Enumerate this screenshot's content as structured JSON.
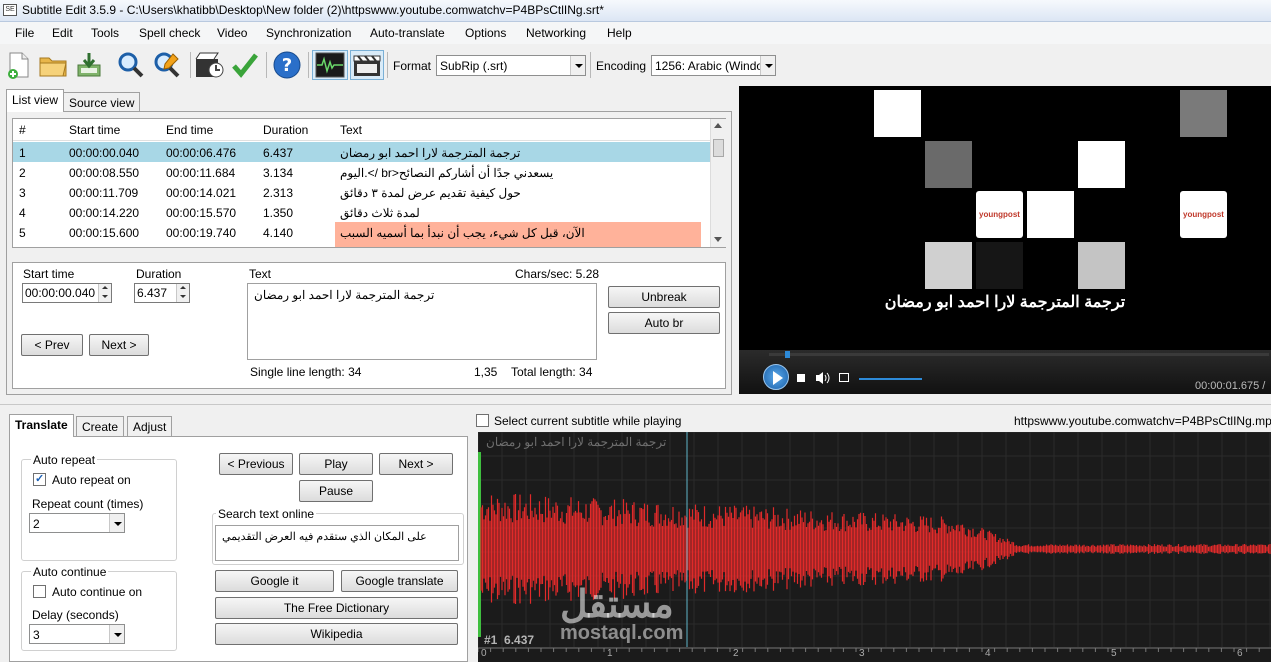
{
  "window": {
    "title": "Subtitle Edit 3.5.9 - C:\\Users\\khatibb\\Desktop\\New folder (2)\\httpswww.youtube.comwatchv=P4BPsCtlINg.srt*"
  },
  "menu": [
    "File",
    "Edit",
    "Tools",
    "Spell check",
    "Video",
    "Synchronization",
    "Auto-translate",
    "Options",
    "Networking",
    "Help"
  ],
  "toolbar": {
    "icons": [
      "new-file-icon",
      "open-folder-icon",
      "save-download-icon",
      "search-icon",
      "replace-icon",
      "visual-sync-icon",
      "spell-check-icon",
      "help-icon",
      "waveform-icon",
      "video-clapper-icon"
    ],
    "format_label": "Format",
    "format_value": "SubRip (.srt)",
    "encoding_label": "Encoding",
    "encoding_value": "1256: Arabic (Windo"
  },
  "view_tabs": [
    "List view",
    "Source view"
  ],
  "grid": {
    "columns": [
      "#",
      "Start time",
      "End time",
      "Duration",
      "Text"
    ],
    "rows": [
      {
        "num": "1",
        "start": "00:00:00.040",
        "end": "00:00:06.476",
        "dur": "6.437",
        "text": "ترجمة المترجمة لارا احمد ابو رمضان",
        "state": "selected"
      },
      {
        "num": "2",
        "start": "00:00:08.550",
        "end": "00:00:11.684",
        "dur": "3.134",
        "text": "يسعدني جدًا أن أشاركم النصائح<br />.اليوم",
        "state": "normal"
      },
      {
        "num": "3",
        "start": "00:00:11.709",
        "end": "00:00:14.021",
        "dur": "2.313",
        "text": "حول كيفية تقديم عرض لمدة ٣ دقائق",
        "state": "normal"
      },
      {
        "num": "4",
        "start": "00:00:14.220",
        "end": "00:00:15.570",
        "dur": "1.350",
        "text": "لمدة ثلاث دقائق",
        "state": "normal"
      },
      {
        "num": "5",
        "start": "00:00:15.600",
        "end": "00:00:19.740",
        "dur": "4.140",
        "text": "الآن، قبل كل شيء، يجب أن نبدأ بما أسميه السبب",
        "state": "error"
      }
    ]
  },
  "editor": {
    "start_time_label": "Start time",
    "start_time_value": "00:00:00.040",
    "duration_label": "Duration",
    "duration_value": "6.437",
    "text_label": "Text",
    "chars_sec": "Chars/sec: 5.28",
    "text_value": "ترجمة المترجمة لارا احمد ابو رمضان",
    "unbreak": "Unbreak",
    "auto_br": "Auto br",
    "prev": "< Prev",
    "next": "Next >",
    "single_line_length": "Single line length: 34",
    "position": "1,35",
    "total_length": "Total length: 34"
  },
  "video": {
    "subtitle": "ترجمة المترجمة لارا احمد ابو رمضان",
    "time": "00:00:01.675 /",
    "logo_text": "youngpost"
  },
  "bottom_tabs": [
    "Translate",
    "Create",
    "Adjust"
  ],
  "translate": {
    "auto_repeat_title": "Auto repeat",
    "auto_repeat_on": "Auto repeat on",
    "repeat_count_label": "Repeat count (times)",
    "repeat_count_value": "2",
    "auto_continue_title": "Auto continue",
    "auto_continue_on": "Auto continue on",
    "delay_label": "Delay (seconds)",
    "delay_value": "3",
    "prev": "< Previous",
    "play": "Play",
    "next": "Next >",
    "pause": "Pause",
    "search_label": "Search text online",
    "search_text": "على المكان الذي ستقدم فيه العرض التقديمي",
    "google_it": "Google it",
    "google_translate": "Google translate",
    "free_dictionary": "The Free Dictionary",
    "wikipedia": "Wikipedia"
  },
  "waveform": {
    "select_current": "Select current subtitle while playing",
    "filename": "httpswww.youtube.comwatchv=P4BPsCtlINg.mp",
    "subtitle_overlay": "ترجمة المترجمة لارا احمد ابو رمضان",
    "marker": "#1  6.437",
    "ruler": [
      "0",
      "1",
      "2",
      "3",
      "4",
      "5",
      "6"
    ],
    "watermark_ar": "مستقل",
    "watermark_en": "mostaql.com"
  },
  "colors": {
    "selected_row": "#a8d7e6",
    "error_row": "#ffb29a",
    "wave_red": "#e02a2a",
    "wave_bg": "#1b1b1b"
  }
}
